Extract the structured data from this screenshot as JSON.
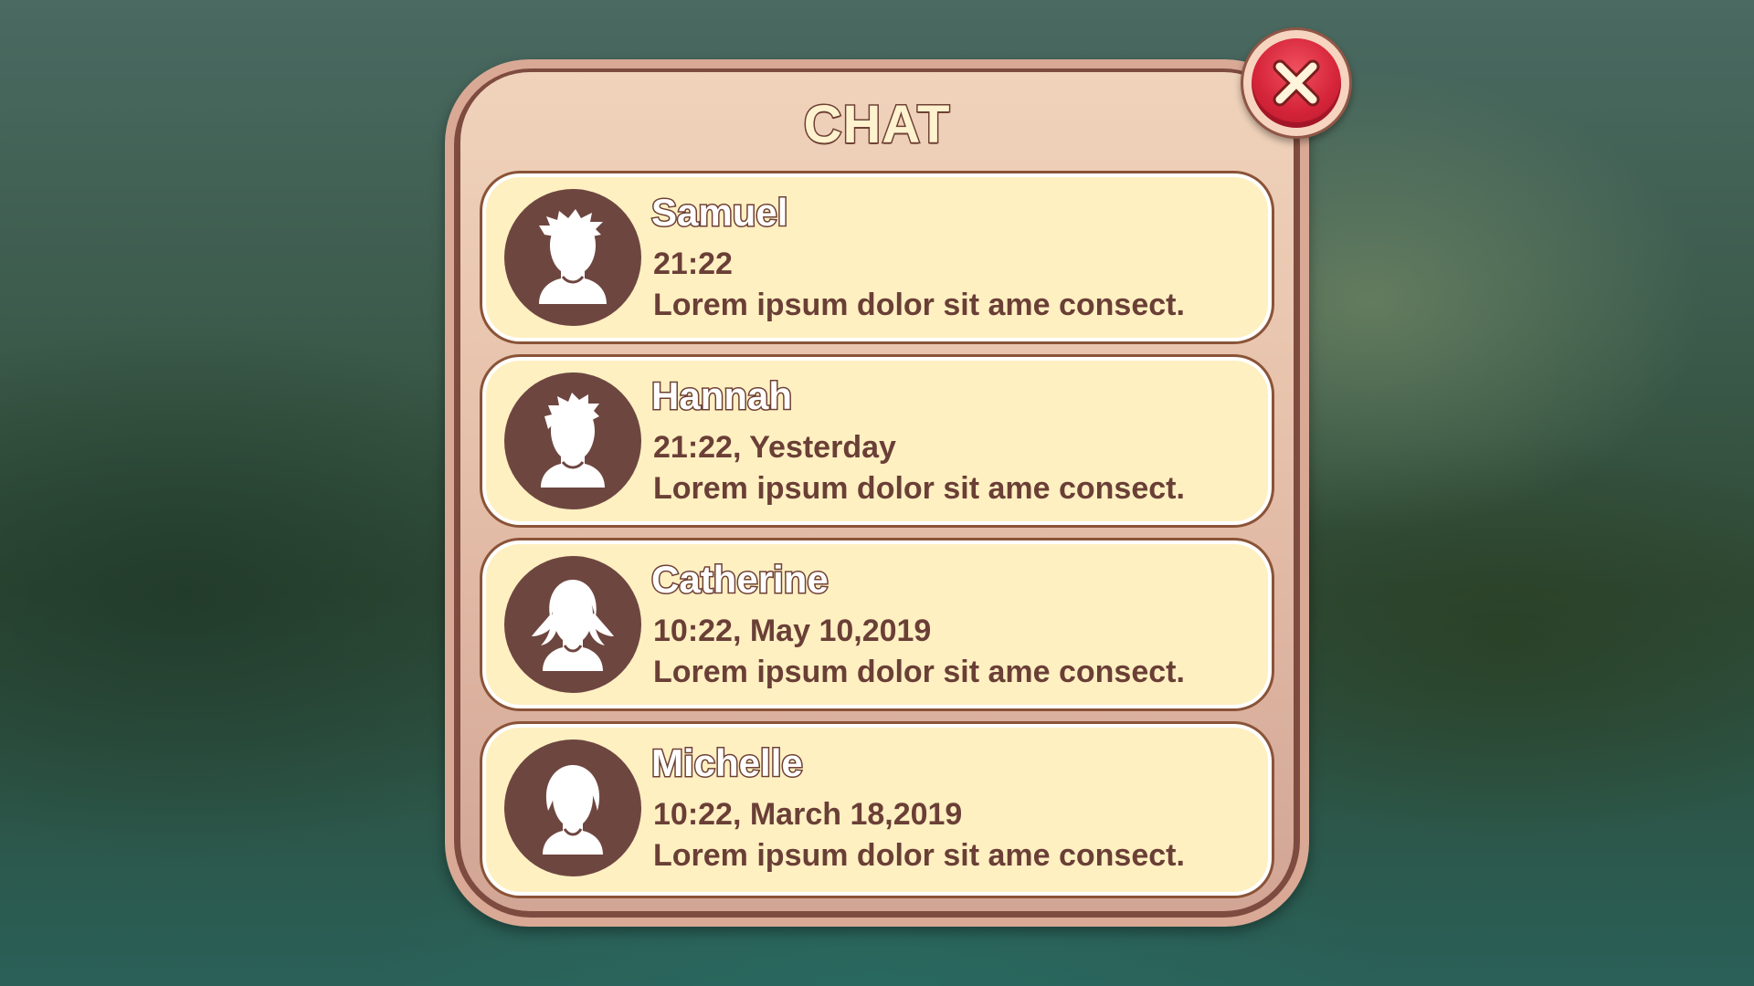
{
  "window": {
    "title": "CHAT"
  },
  "close_button": {
    "icon": "close-icon"
  },
  "colors": {
    "panel_border": "#7e4b40",
    "panel_face": "#e6c0aa",
    "item_face": "#fff0c2",
    "avatar_bg": "#6e4640",
    "text_dark": "#6a3f36",
    "close_red": "#d6253a"
  },
  "chats": [
    {
      "name": "Samuel",
      "time": "21:22",
      "message": "Lorem ipsum dolor sit ame consect.",
      "avatar_icon": "male-spiky-hair-avatar-icon"
    },
    {
      "name": "Hannah",
      "time": "21:22, Yesterday",
      "message": "Lorem ipsum dolor sit ame consect.",
      "avatar_icon": "male-short-hair-avatar-icon"
    },
    {
      "name": "Catherine",
      "time": "10:22, May 10,2019",
      "message": "Lorem ipsum dolor sit ame consect.",
      "avatar_icon": "female-pigtails-avatar-icon"
    },
    {
      "name": "Michelle",
      "time": "10:22, March 18,2019",
      "message": "Lorem ipsum dolor sit ame consect.",
      "avatar_icon": "female-bob-hair-avatar-icon"
    }
  ]
}
